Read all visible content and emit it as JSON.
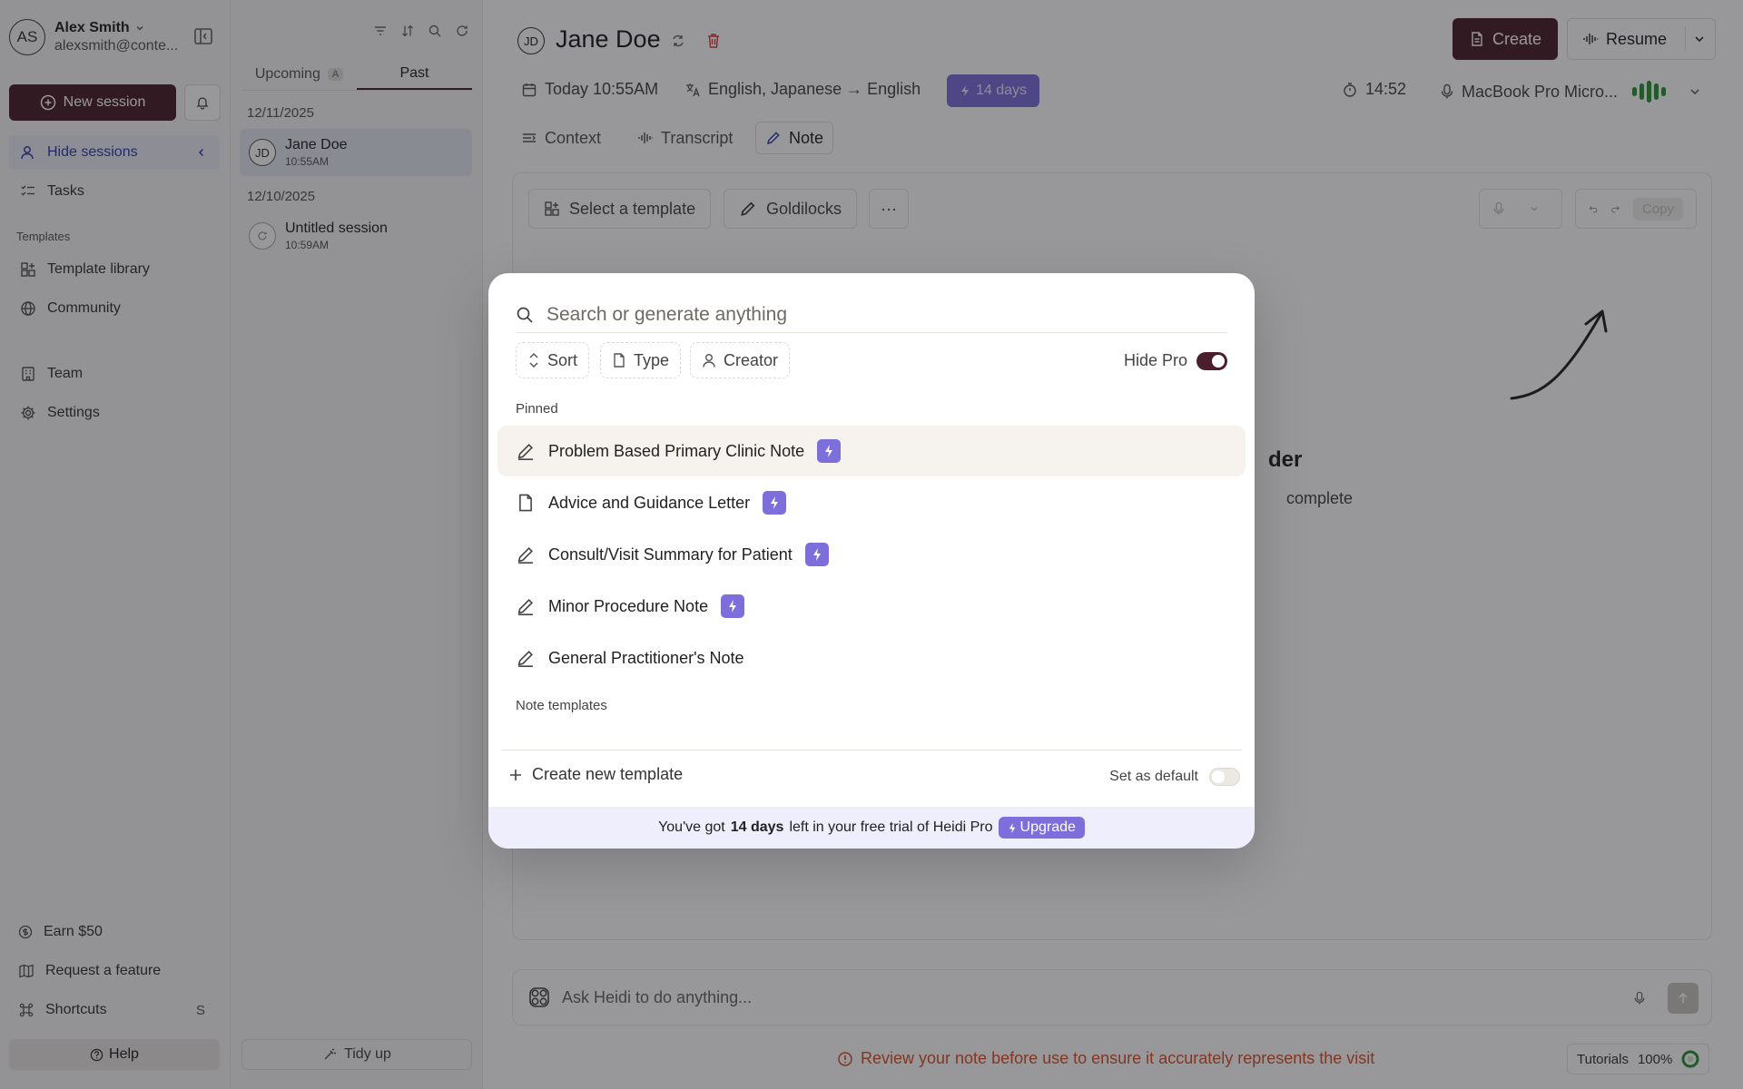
{
  "sidebar": {
    "account": {
      "initials": "AS",
      "name": "Alex Smith",
      "email": "alexsmith@conte..."
    },
    "new_session_label": "New session",
    "nav": [
      {
        "label": "Hide sessions"
      },
      {
        "label": "Tasks"
      }
    ],
    "templates_section_label": "Templates",
    "templates_nav": [
      {
        "label": "Template library"
      },
      {
        "label": "Community"
      }
    ],
    "org_nav": [
      {
        "label": "Team"
      },
      {
        "label": "Settings"
      }
    ],
    "footer_nav": [
      {
        "label": "Earn $50"
      },
      {
        "label": "Request a feature"
      },
      {
        "label": "Shortcuts",
        "shortcut": "S"
      }
    ],
    "help_label": "Help"
  },
  "sessions": {
    "tabs": [
      {
        "label": "Upcoming",
        "badge": "A"
      },
      {
        "label": "Past"
      }
    ],
    "groups": [
      {
        "date": "12/11/2025",
        "items": [
          {
            "initials": "JD",
            "name": "Jane Doe",
            "time": "10:55AM"
          }
        ]
      },
      {
        "date": "12/10/2025",
        "items": [
          {
            "name": "Untitled session",
            "time": "10:59AM"
          }
        ]
      }
    ],
    "tidy_label": "Tidy up"
  },
  "header": {
    "patient_initials": "JD",
    "patient_name": "Jane Doe",
    "create_label": "Create",
    "resume_label": "Resume",
    "date": "Today 10:55AM",
    "languages": "English, Japanese → English",
    "trial_pill": "14 days",
    "timer": "14:52",
    "mic_source": "MacBook Pro Micro..."
  },
  "view_tabs": [
    {
      "label": "Context"
    },
    {
      "label": "Transcript"
    },
    {
      "label": "Note"
    }
  ],
  "note_toolbar": {
    "select_template": "Select a template",
    "goldilocks": "Goldilocks",
    "more": "···",
    "copy": "Copy"
  },
  "background_text": {
    "heading_fragment": "der",
    "sub_fragment": "complete"
  },
  "ask_bar": {
    "placeholder": "Ask Heidi to do anything..."
  },
  "warning": "Review your note before use to ensure it accurately represents the visit",
  "tutorials": {
    "label": "Tutorials",
    "zoom": "100%"
  },
  "modal": {
    "search_placeholder": "Search or generate anything",
    "filters": [
      {
        "label": "Sort"
      },
      {
        "label": "Type"
      },
      {
        "label": "Creator"
      }
    ],
    "hide_pro_label": "Hide Pro",
    "hide_pro_on": true,
    "pinned_label": "Pinned",
    "pinned": [
      {
        "label": "Problem Based Primary Clinic Note",
        "icon": "pencil-icon",
        "pro": true
      },
      {
        "label": "Advice and Guidance Letter",
        "icon": "document-icon",
        "pro": true
      },
      {
        "label": "Consult/Visit Summary for Patient",
        "icon": "pencil-icon",
        "pro": true
      },
      {
        "label": "Minor Procedure Note",
        "icon": "pencil-icon",
        "pro": true
      },
      {
        "label": "General Practitioner's Note",
        "icon": "pencil-icon",
        "pro": false
      }
    ],
    "note_templates_label": "Note templates",
    "create_template_label": "Create new template",
    "set_default_label": "Set as default",
    "set_default_on": false,
    "trial_bar": {
      "prefix": "You've got",
      "days": "14 days",
      "suffix": "left in your free trial of Heidi Pro",
      "upgrade_label": "Upgrade"
    }
  },
  "colors": {
    "brand": "#4a1f2b",
    "pro": "#7c6fdb",
    "warning": "#d8502c",
    "active_nav": "#2d3fae"
  }
}
